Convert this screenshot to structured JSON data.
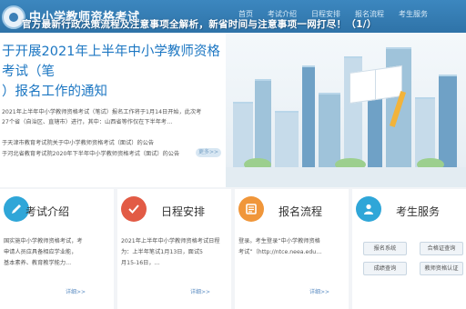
{
  "header": {
    "site_title": "中小学教师资格考试",
    "nav": [
      "首页",
      "考试介绍",
      "日程安排",
      "报名流程",
      "考生服务"
    ],
    "overlay_banner": "官方最新行政决策流程及注意事项全解析，新省时间与注意事项一网打尽！（1/）"
  },
  "hero": {
    "title": "于开展2021年上半年中小学教师资格考试（笔\n）报名工作的通知",
    "desc_lines": [
      "2021年上半年中小学教师资格考试（笔试）报名工作将于1月14日开始，此次考",
      "27个省（自治区、直辖市）进行，其中：山西省等作仅在下半年考…"
    ],
    "links": [
      "于天津市教育考试院关于中小学教师资格考试（面试）的公告",
      "于河北省教育考试院2020年下半年中小学教师资格考试（面试）的公告"
    ],
    "more_label": "更多>>"
  },
  "cards": [
    {
      "title": "考试介绍",
      "body": [
        "国实施中小学教师资格考试，考",
        "申请人员应具备相应学业能，",
        "基本素养、教育教学能力…"
      ],
      "more": "详细>>"
    },
    {
      "title": "日程安排",
      "body": [
        "2021年上半年中小学教师资格考试日程",
        "为：上半年笔试1月13日，面试5",
        "月15-16日，…"
      ],
      "more": "详细>>"
    },
    {
      "title": "报名流程",
      "body": [
        "登录。考生登录“中小学教师资格",
        "考试”（http://ntce.neea.edu…"
      ],
      "more": "详细>>"
    },
    {
      "title": "考生服务",
      "buttons": [
        "报名系统",
        "合格证查询",
        "成绩查询",
        "教师资格认证"
      ]
    }
  ],
  "colors": {
    "primary": "#2f73a8",
    "accent_red": "#e25b45",
    "accent_orange": "#f0963a",
    "accent_blue": "#2fa6d8"
  },
  "icons": [
    "pencil-icon",
    "checkmark-icon",
    "flow-icon",
    "person-icon"
  ]
}
